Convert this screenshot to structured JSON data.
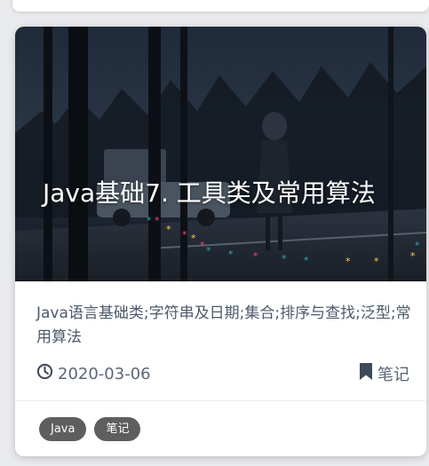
{
  "post": {
    "title": "Java基础7. 工具类及常用算法",
    "description": "Java语言基础类;字符串及日期;集合;排序与查找;泛型;常用算法",
    "date": "2020-03-06",
    "category": "笔记",
    "tags": [
      "Java",
      "笔记"
    ]
  },
  "icons": {
    "date": "clock-icon",
    "category": "bookmark-icon"
  },
  "colors": {
    "tag_bg": "#5e5e5e",
    "meta_text": "#5a6677",
    "desc_text": "#4c5a6b"
  }
}
